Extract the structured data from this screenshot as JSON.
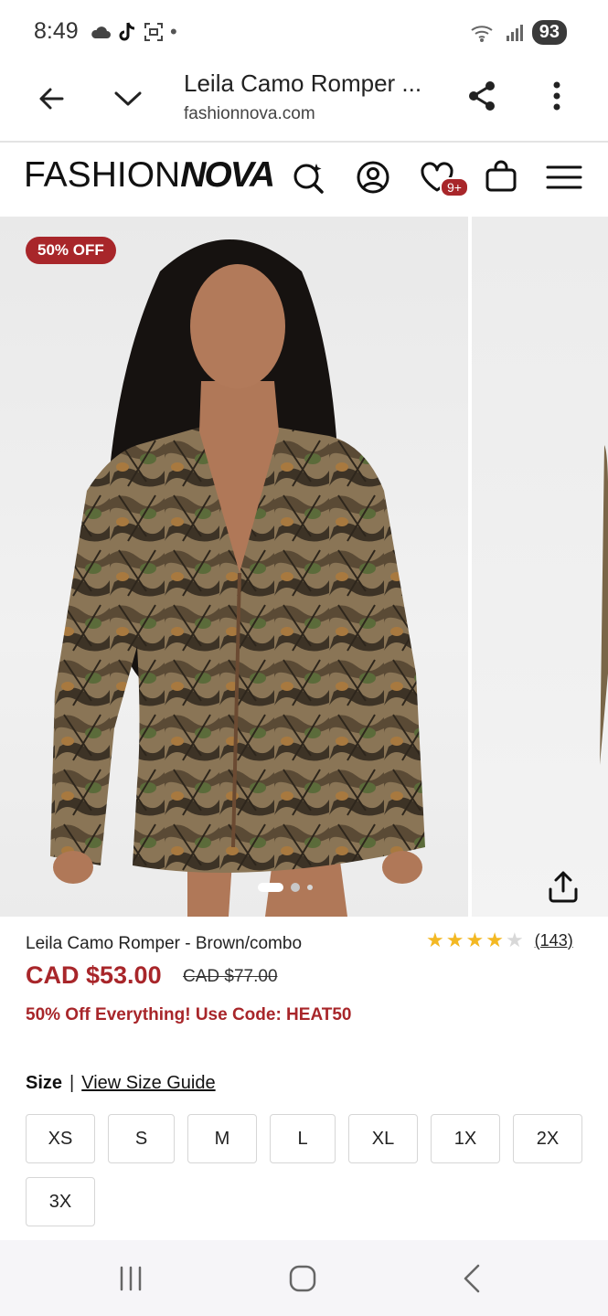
{
  "status_bar": {
    "time": "8:49",
    "battery": "93"
  },
  "browser": {
    "title": "Leila Camo Romper ...",
    "url": "fashionnova.com"
  },
  "header": {
    "logo_thin": "FASHION",
    "logo_bold": "NOVA",
    "wishlist_badge": "9+"
  },
  "gallery": {
    "discount_badge": "50% OFF",
    "slide_count": 3,
    "active_slide": 1
  },
  "product": {
    "name": "Leila Camo Romper - Brown/combo",
    "rating": 4,
    "max_rating": 5,
    "review_count": "(143)",
    "price": "CAD $53.00",
    "original_price": "CAD $77.00",
    "promo": "50% Off Everything! Use Code: HEAT50"
  },
  "size": {
    "label": "Size",
    "separator": "|",
    "guide_link": "View Size Guide",
    "options": [
      "XS",
      "S",
      "M",
      "L",
      "XL",
      "1X",
      "2X",
      "3X"
    ]
  },
  "colors": {
    "brand_red": "#a8262a",
    "star": "#f3b823"
  }
}
